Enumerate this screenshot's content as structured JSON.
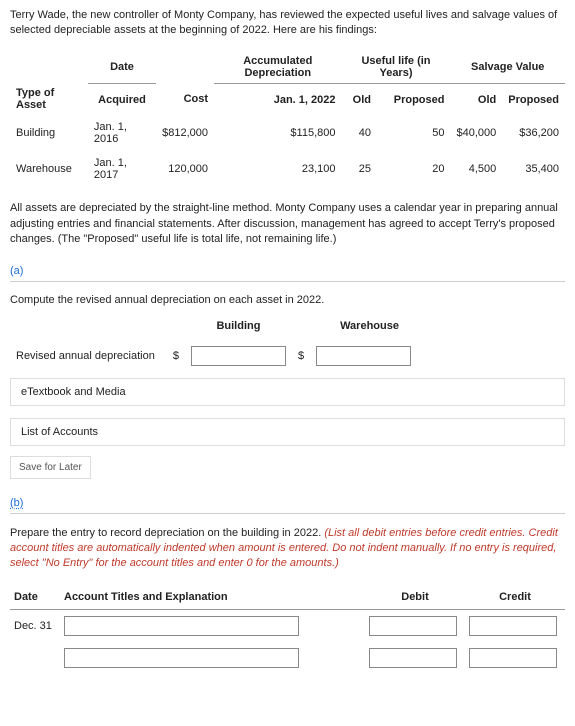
{
  "intro": "Terry Wade, the new controller of Monty Company, has reviewed the expected useful lives and salvage values of selected depreciable assets at the beginning of 2022. Here are his findings:",
  "table1": {
    "group_headers": {
      "blank": "",
      "date": "Date",
      "accum": "Accumulated Depreciation",
      "life": "Useful life (in Years)",
      "salvage": "Salvage Value"
    },
    "col_headers": {
      "type": "Type of Asset",
      "acquired": "Acquired",
      "cost": "Cost",
      "jan": "Jan. 1, 2022",
      "old1": "Old",
      "prop1": "Proposed",
      "old2": "Old",
      "prop2": "Proposed"
    },
    "rows": [
      {
        "type": "Building",
        "acquired": "Jan. 1, 2016",
        "cost": "$812,000",
        "accum": "$115,800",
        "old_life": "40",
        "prop_life": "50",
        "old_salv": "$40,000",
        "prop_salv": "$36,200"
      },
      {
        "type": "Warehouse",
        "acquired": "Jan. 1, 2017",
        "cost": "120,000",
        "accum": "23,100",
        "old_life": "25",
        "prop_life": "20",
        "old_salv": "4,500",
        "prop_salv": "35,400"
      }
    ]
  },
  "para2": "All assets are depreciated by the straight-line method. Monty Company uses a calendar year in preparing annual adjusting entries and financial statements. After discussion, management has agreed to accept Terry's proposed changes. (The \"Proposed\" useful life is total life, not remaining life.)",
  "partA": {
    "label": "(a)",
    "instr": "Compute the revised annual depreciation on each asset in 2022.",
    "col_building": "Building",
    "col_warehouse": "Warehouse",
    "row_label": "Revised annual depreciation",
    "currency": "$"
  },
  "links": {
    "etext": "eTextbook and Media",
    "accounts": "List of Accounts"
  },
  "save": "Save for Later",
  "partB": {
    "label": "(b)",
    "instr_black": "Prepare the entry to record depreciation on the building in 2022. ",
    "instr_red": "(List all debit entries before credit entries. Credit account titles are automatically indented when amount is entered. Do not indent manually. If no entry is required, select \"No Entry\" for the account titles and enter 0 for the amounts.)",
    "cols": {
      "date": "Date",
      "acct": "Account Titles and Explanation",
      "debit": "Debit",
      "credit": "Credit"
    },
    "date_val": "Dec. 31"
  }
}
